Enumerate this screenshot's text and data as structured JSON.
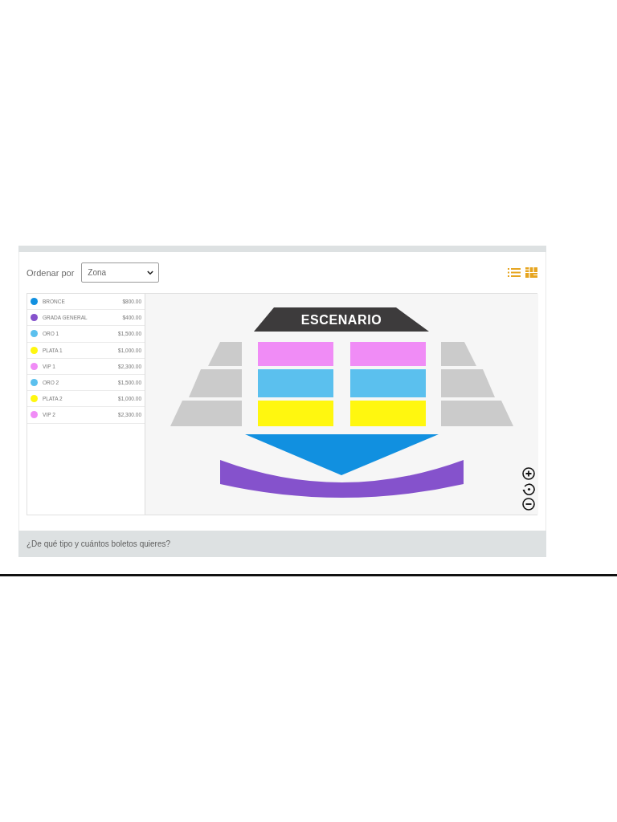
{
  "sort": {
    "label": "Ordenar por",
    "value": "Zona"
  },
  "zones": [
    {
      "name": "BRONCE",
      "price": "$800.00",
      "color": "#1190e0"
    },
    {
      "name": "GRADA GENERAL",
      "price": "$400.00",
      "color": "#8552cc"
    },
    {
      "name": "ORO 1",
      "price": "$1,500.00",
      "color": "#5bc0ee"
    },
    {
      "name": "PLATA 1",
      "price": "$1,000.00",
      "color": "#fff70f"
    },
    {
      "name": "VIP 1",
      "price": "$2,300.00",
      "color": "#f08cf6"
    },
    {
      "name": "ORO 2",
      "price": "$1,500.00",
      "color": "#5bc0ee"
    },
    {
      "name": "PLATA 2",
      "price": "$1,000.00",
      "color": "#fff70f"
    },
    {
      "name": "VIP 2",
      "price": "$2,300.00",
      "color": "#f08cf6"
    }
  ],
  "map": {
    "stage_label": "ESCENARIO"
  },
  "footer": {
    "question": "¿De qué tipo y cuántos boletos quieres?"
  }
}
